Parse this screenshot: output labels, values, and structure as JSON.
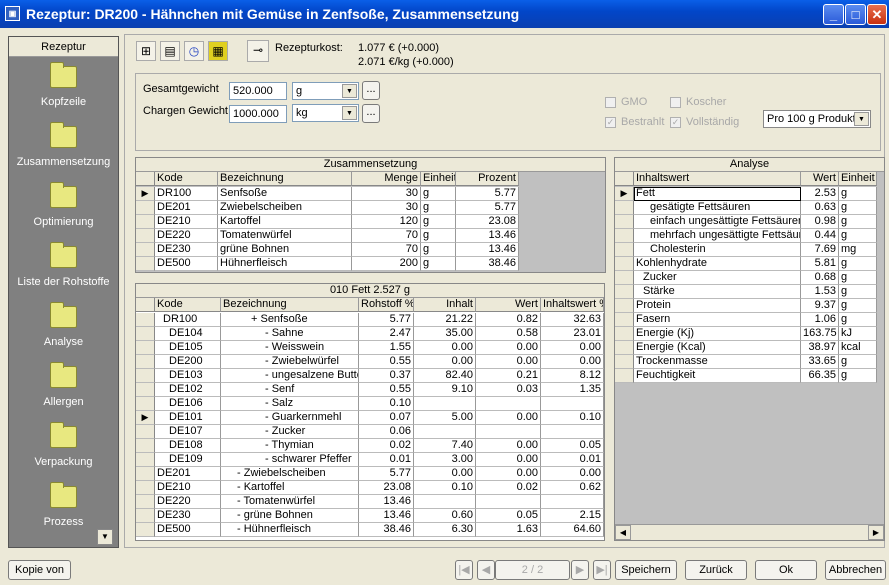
{
  "window": {
    "title": "Rezeptur: DR200 - Hähnchen mit Gemüse in Zenfsoße,   Zusammensetzung"
  },
  "sidebar": {
    "header": "Rezeptur",
    "items": [
      {
        "label": "Kopfzeile"
      },
      {
        "label": "Zusammensetzung"
      },
      {
        "label": "Optimierung"
      },
      {
        "label": "Liste der Rohstoffe"
      },
      {
        "label": "Analyse"
      },
      {
        "label": "Allergen"
      },
      {
        "label": "Verpackung"
      },
      {
        "label": "Prozess"
      }
    ]
  },
  "toolbar": {
    "icons": [
      "tree-icon",
      "table-percent-icon",
      "clock-plus-minus-icon",
      "yellow-pattern-icon"
    ],
    "cost_label": "Rezepturkost:",
    "cost_total": "1.077 € (+0.000)",
    "cost_per_kg": "2.071 €/kg (+0.000)"
  },
  "weights": {
    "total_label": "Gesamtgewicht",
    "total_value": "520.000",
    "total_unit": "g",
    "batch_label": "Chargen Gewicht",
    "batch_value": "1000.000",
    "batch_unit": "kg",
    "browse": "..."
  },
  "flags": {
    "gmo": {
      "label": "GMO",
      "checked": false
    },
    "koscher": {
      "label": "Koscher",
      "checked": false
    },
    "bestrahlt": {
      "label": "Bestrahlt",
      "checked": true
    },
    "vollstaendig": {
      "label": "Vollständig",
      "checked": true
    },
    "basis": "Pro 100 g Produkt"
  },
  "composition": {
    "title": "Zusammensetzung",
    "columns": [
      "Kode",
      "Bezeichnung",
      "Menge",
      "Einheit",
      "Prozent"
    ],
    "selected": 0,
    "rows": [
      [
        "DR100",
        "Senfsoße",
        "30",
        "g",
        "5.77"
      ],
      [
        "DE201",
        "Zwiebelscheiben",
        "30",
        "g",
        "5.77"
      ],
      [
        "DE210",
        "Kartoffel",
        "120",
        "g",
        "23.08"
      ],
      [
        "DE220",
        "Tomatenwürfel",
        "70",
        "g",
        "13.46"
      ],
      [
        "DE230",
        "grüne Bohnen",
        "70",
        "g",
        "13.46"
      ],
      [
        "DE500",
        "Hühnerfleisch",
        "200",
        "g",
        "38.46"
      ]
    ]
  },
  "detail": {
    "title": "010  Fett  2.527  g",
    "columns": [
      "Kode",
      "Bezeichnung",
      "Rohstoff %",
      "Inhalt",
      "Wert",
      "Inhaltswert %"
    ],
    "selected": 7,
    "rows": [
      [
        "DR100",
        "+ Senfsoße",
        "5.77",
        "21.22",
        "0.82",
        "32.63",
        1
      ],
      [
        "DE104",
        "- Sahne",
        "2.47",
        "35.00",
        "0.58",
        "23.01",
        2
      ],
      [
        "DE105",
        "- Weisswein",
        "1.55",
        "0.00",
        "0.00",
        "0.00",
        2
      ],
      [
        "DE200",
        "- Zwiebelwürfel",
        "0.55",
        "0.00",
        "0.00",
        "0.00",
        2
      ],
      [
        "DE103",
        "- ungesalzene Butter",
        "0.37",
        "82.40",
        "0.21",
        "8.12",
        2
      ],
      [
        "DE102",
        "- Senf",
        "0.55",
        "9.10",
        "0.03",
        "1.35",
        2
      ],
      [
        "DE106",
        "- Salz",
        "0.10",
        "",
        "",
        "",
        2
      ],
      [
        "DE101",
        "- Guarkernmehl",
        "0.07",
        "5.00",
        "0.00",
        "0.10",
        2
      ],
      [
        "DE107",
        "- Zucker",
        "0.06",
        "",
        "",
        "",
        2
      ],
      [
        "DE108",
        "- Thymian",
        "0.02",
        "7.40",
        "0.00",
        "0.05",
        2
      ],
      [
        "DE109",
        "- schwarer Pfeffer",
        "0.01",
        "3.00",
        "0.00",
        "0.01",
        2
      ],
      [
        "DE201",
        "- Zwiebelscheiben",
        "5.77",
        "0.00",
        "0.00",
        "0.00",
        0
      ],
      [
        "DE210",
        "- Kartoffel",
        "23.08",
        "0.10",
        "0.02",
        "0.62",
        0
      ],
      [
        "DE220",
        "- Tomatenwürfel",
        "13.46",
        "",
        "",
        "",
        0
      ],
      [
        "DE230",
        "- grüne Bohnen",
        "13.46",
        "0.60",
        "0.05",
        "2.15",
        0
      ],
      [
        "DE500",
        "- Hühnerfleisch",
        "38.46",
        "6.30",
        "1.63",
        "64.60",
        0
      ]
    ]
  },
  "analysis": {
    "title": "Analyse",
    "columns": [
      "Inhaltswert",
      "Wert",
      "Einheit"
    ],
    "selected": 0,
    "rows": [
      [
        "Fett",
        "2.53",
        "g",
        0
      ],
      [
        "gesätigte Fettsäuren",
        "0.63",
        "g",
        2
      ],
      [
        "einfach ungesättigte Fettsäuren",
        "0.98",
        "g",
        2
      ],
      [
        "mehrfach ungesättigte Fettsäuren",
        "0.44",
        "g",
        2
      ],
      [
        "Cholesterin",
        "7.69",
        "mg",
        2
      ],
      [
        "Kohlenhydrate",
        "5.81",
        "g",
        0
      ],
      [
        "Zucker",
        "0.68",
        "g",
        1
      ],
      [
        "Stärke",
        "1.53",
        "g",
        1
      ],
      [
        "Protein",
        "9.37",
        "g",
        0
      ],
      [
        "Fasern",
        "1.06",
        "g",
        0
      ],
      [
        "Energie (Kj)",
        "163.75",
        "kJ",
        0
      ],
      [
        "Energie (Kcal)",
        "38.97",
        "kcal",
        0
      ],
      [
        "Trockenmasse",
        "33.65",
        "g",
        0
      ],
      [
        "Feuchtigkeit",
        "66.35",
        "g",
        0
      ]
    ]
  },
  "footer": {
    "copy": "Kopie von",
    "page": "2 / 2",
    "save": "Speichern",
    "back": "Zurück",
    "ok": "Ok",
    "cancel": "Abbrechen"
  }
}
